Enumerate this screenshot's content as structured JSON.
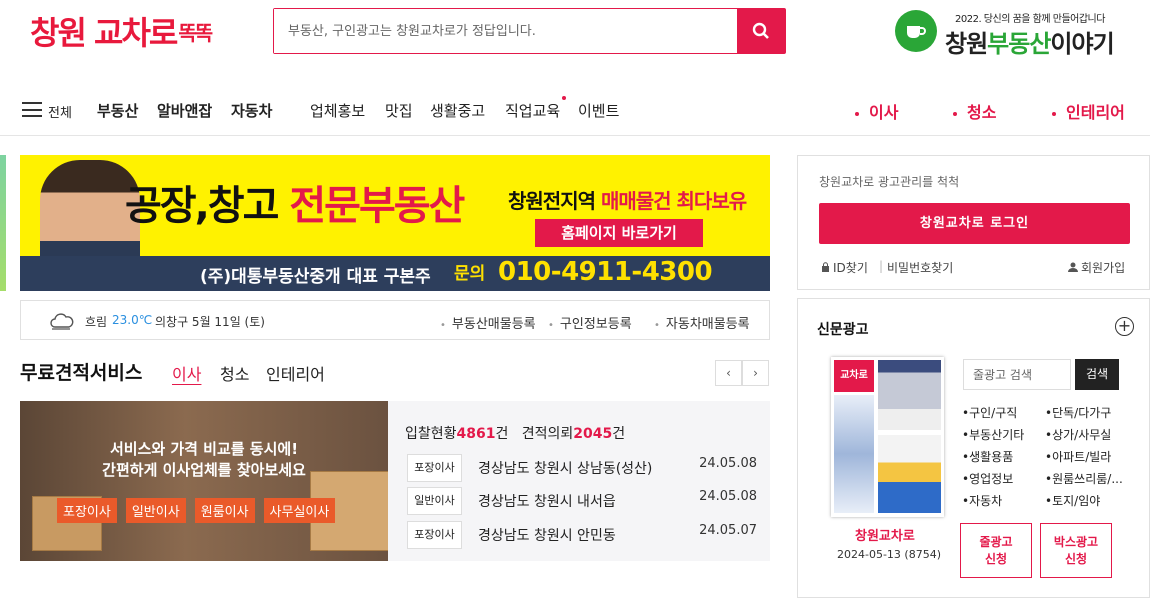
{
  "header": {
    "logo_text": "창원 교차로",
    "logo_suffix": "똑똑",
    "search_placeholder": "부동산, 구인광고는 창원교차로가 정답입니다.",
    "brand_sub": "2022. 당신의 꿈을 함께 만들어갑니다",
    "brand_main_1": "창원",
    "brand_main_2": "부동산",
    "brand_main_3": "이야기"
  },
  "nav": {
    "all_label": "전체",
    "primary": [
      "부동산",
      "알바앤잡",
      "자동차"
    ],
    "secondary": [
      "업체홍보",
      "맛집",
      "생활중고",
      "직업교육",
      "이벤트"
    ],
    "highlight": [
      "이사",
      "청소",
      "인테리어"
    ]
  },
  "banner": {
    "headline_1": "공장,창고",
    "headline_2": "전문부동산",
    "sub_1": "창원전지역",
    "sub_2": "매매물건 최다보유",
    "homepage_button": "홈페이지 바로가기",
    "company": "(주)대통부동산중개 대표 구본주",
    "contact_label": "문의",
    "phone": "010-4911-4300"
  },
  "weather": {
    "condition": "흐림",
    "temp": "23.0℃",
    "location_date": "의창구 5월 11일 (토)",
    "links": [
      "부동산매물등록",
      "구인정보등록",
      "자동차매물등록"
    ]
  },
  "estimate": {
    "title": "무료견적서비스",
    "tabs": [
      "이사",
      "청소",
      "인테리어"
    ],
    "active_tab": "이사",
    "promo_line1": "서비스와 가격 비교를 동시에!",
    "promo_line2": "간편하게 이사업체를 찾아보세요",
    "promo_tags": [
      "포장이사",
      "일반이사",
      "원룸이사",
      "사무실이사"
    ],
    "stat_bid_label": "입찰현황",
    "stat_bid_count": "4861",
    "stat_req_label": "견적의뢰",
    "stat_req_count": "2045",
    "unit": "건",
    "rows": [
      {
        "type": "포장이사",
        "address": "경상남도 창원시 상남동(성산)",
        "date": "24.05.08"
      },
      {
        "type": "일반이사",
        "address": "경상남도 창원시 내서읍",
        "date": "24.05.08"
      },
      {
        "type": "포장이사",
        "address": "경상남도 창원시 안민동",
        "date": "24.05.07"
      }
    ]
  },
  "login": {
    "heading": "창원교차로 광고관리를 척척",
    "login_button": "창원교차로 로그인",
    "find_id": "ID찾기",
    "find_pw": "비밀번호찾기",
    "signup": "회원가입"
  },
  "newspaper": {
    "title": "신문광고",
    "paper_logo": "교차로",
    "paper_name": "창원교차로",
    "paper_date": "2024-05-13 (8754)",
    "search_placeholder": "줄광고 검색",
    "search_button": "검색",
    "categories_left": [
      "•구인/구직",
      "•부동산기타",
      "•생활용품",
      "•영업정보",
      "•자동차"
    ],
    "categories_right": [
      "•단독/다가구",
      "•상가/사무실",
      "•아파트/빌라",
      "•원룸쓰리룸/...",
      "•토지/임야"
    ],
    "btn_line_ad_1": "줄광고",
    "btn_line_ad_2": "신청",
    "btn_box_ad_1": "박스광고",
    "btn_box_ad_2": "신청"
  },
  "colors": {
    "accent": "#e3194a",
    "brand_green": "#2aa637",
    "banner_yellow": "#fff200",
    "banner_navy": "#2d3e5c"
  }
}
